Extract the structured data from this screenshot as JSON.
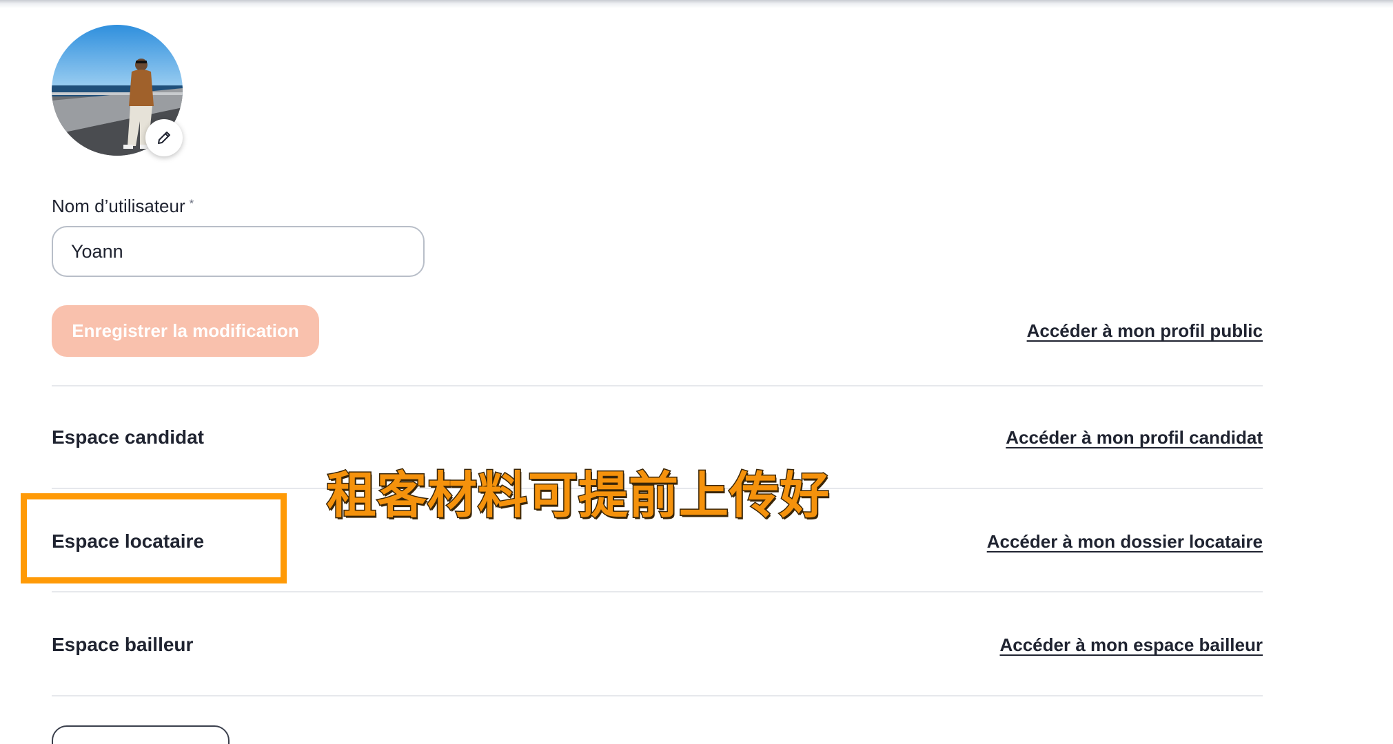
{
  "profile": {
    "avatar_icon": "person-photo",
    "edit_icon": "pencil-icon",
    "username_label": "Nom d’utilisateur",
    "required_marker": "*",
    "username_value": "Yoann",
    "save_label": "Enregistrer la modification",
    "public_profile_link": "Accéder à mon profil public"
  },
  "sections": [
    {
      "title": "Espace candidat",
      "link": "Accéder à mon profil candidat"
    },
    {
      "title": "Espace locataire",
      "link": "Accéder à mon dossier locataire"
    },
    {
      "title": "Espace bailleur",
      "link": "Accéder à mon espace bailleur"
    }
  ],
  "overlay": {
    "caption": "租客材料可提前上传好",
    "highlight_color": "#ff9a07"
  },
  "colors": {
    "save_button_bg": "#f9c1ad",
    "text": "#1f2330",
    "caption": "#f5920c"
  }
}
